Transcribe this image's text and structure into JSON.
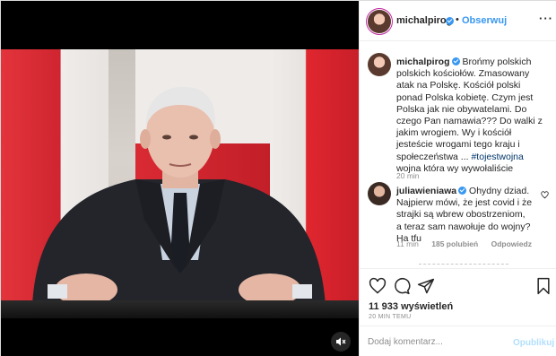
{
  "header": {
    "username": "michalpirog",
    "separator": "•",
    "follow_label": "Obserwuj",
    "more_label": "···"
  },
  "caption": {
    "username": "michalpirog",
    "text_before_tag": "Brońmy polskich polskich kościołów. Zmasowany atak na Polskę. Kościół polski ponad Polska kobietę. Czym jest Polska jak nie obywatelami. Do czego Pan namawia??? Do walki z jakim wrogiem. Wy i kościół jesteście wrogami tego kraju i społeczeństwa ...",
    "tag": "#tojestwojna",
    "text_after_tag": "wojna która wy wywołaliście",
    "time": "20 min"
  },
  "comment": {
    "username": "juliawieniawa",
    "text": "Ohydny dziad. Najpierw mówi, że jest covid i że strajki są wbrew obostrzeniom, a teraz sam nawołuje do wojny? Ha tfu",
    "time": "11 min",
    "likes": "185 polubień",
    "reply_label": "Odpowiedz"
  },
  "stats": {
    "views_count": "11 933",
    "views_label": "wyświetleń",
    "posted": "20 MIN TEMU"
  },
  "add_comment": {
    "placeholder": "Dodaj komentarz...",
    "publish_label": "Opublikuj"
  },
  "colors": {
    "accent": "#3897f0",
    "publish_disabled": "#b2dffc",
    "muted_text": "#8e8e8e",
    "flag_red": "#d1262e"
  },
  "icons": {
    "mute": "muted-speaker-icon",
    "like": "heart-icon",
    "comment": "comment-bubble-icon",
    "share": "paper-plane-icon",
    "save": "bookmark-icon",
    "verified": "verified-badge-icon"
  }
}
